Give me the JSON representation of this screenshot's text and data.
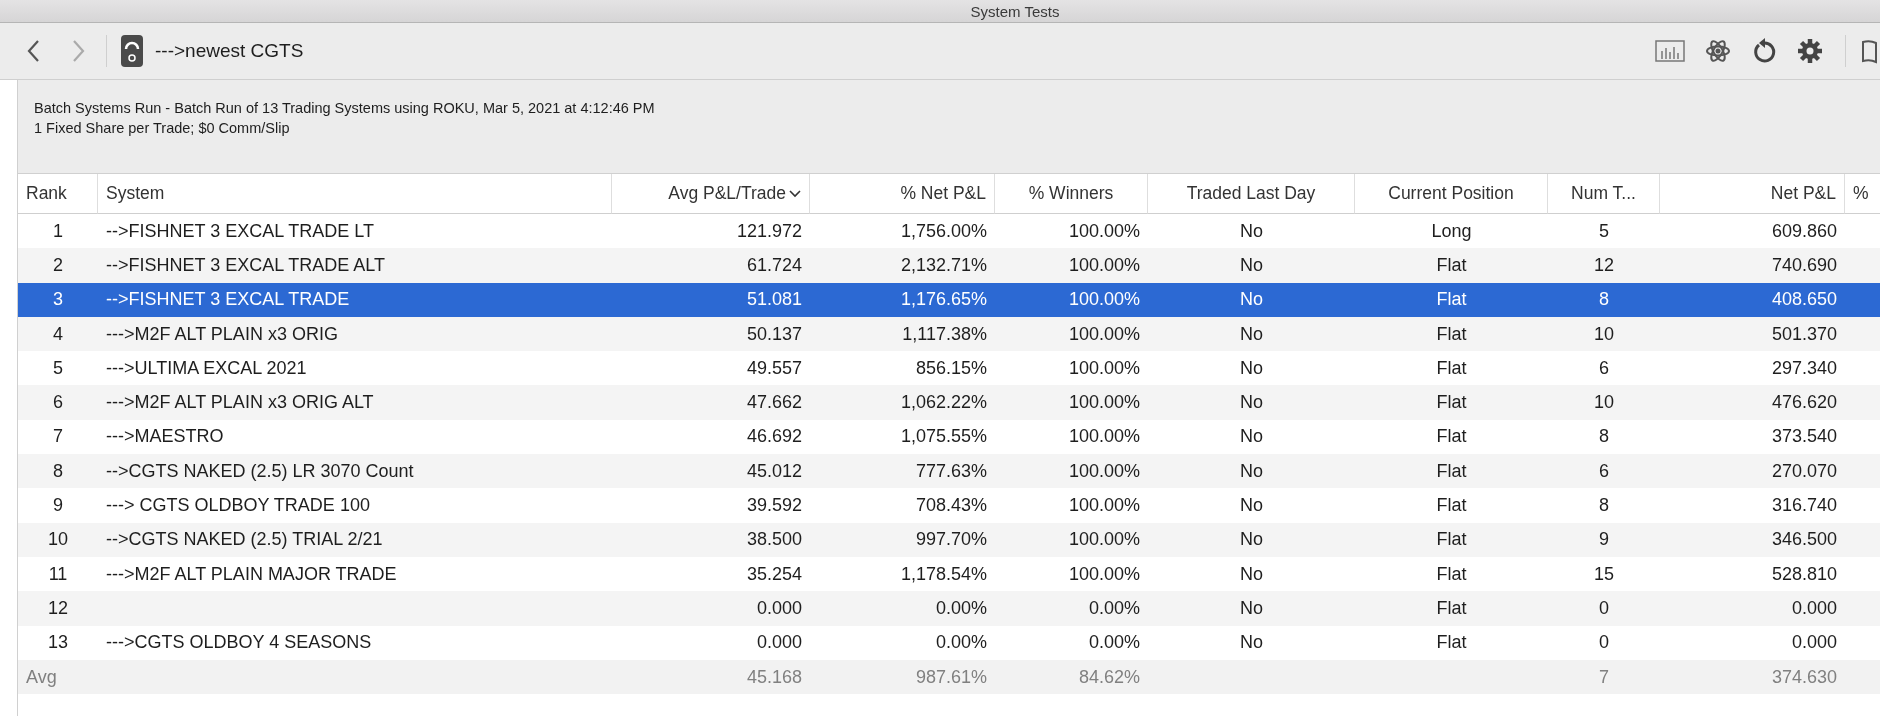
{
  "window": {
    "title": "System Tests"
  },
  "toolbar": {
    "location": "--->newest CGTS"
  },
  "info": {
    "lines": [
      "Batch Systems Run - Batch Run of 13 Trading Systems using ROKU, Mar 5, 2021 at 4:12:46 PM",
      "1 Fixed Share per Trade; $0 Comm/Slip"
    ]
  },
  "table": {
    "columns": [
      {
        "label": "Rank",
        "sorted": false
      },
      {
        "label": "System",
        "sorted": false
      },
      {
        "label": "Avg P&L/Trade",
        "sorted": true
      },
      {
        "label": "% Net P&L",
        "sorted": false
      },
      {
        "label": "% Winners",
        "sorted": false
      },
      {
        "label": "Traded Last Day",
        "sorted": false
      },
      {
        "label": "Current Position",
        "sorted": false
      },
      {
        "label": "Num T...",
        "sorted": false
      },
      {
        "label": "Net P&L",
        "sorted": false
      },
      {
        "label": "%",
        "sorted": false
      }
    ],
    "rows": [
      {
        "kind": "data",
        "selected": false,
        "cells": [
          "1",
          "-->FISHNET 3 EXCAL TRADE LT",
          "121.972",
          "1,756.00%",
          "100.00%",
          "No",
          "Long",
          "5",
          "609.860"
        ]
      },
      {
        "kind": "data",
        "selected": false,
        "cells": [
          "2",
          "-->FISHNET 3 EXCAL TRADE ALT",
          "61.724",
          "2,132.71%",
          "100.00%",
          "No",
          "Flat",
          "12",
          "740.690"
        ]
      },
      {
        "kind": "data",
        "selected": true,
        "cells": [
          "3",
          "-->FISHNET 3 EXCAL TRADE",
          "51.081",
          "1,176.65%",
          "100.00%",
          "No",
          "Flat",
          "8",
          "408.650"
        ]
      },
      {
        "kind": "data",
        "selected": false,
        "cells": [
          "4",
          "--->M2F ALT PLAIN x3 ORIG",
          "50.137",
          "1,117.38%",
          "100.00%",
          "No",
          "Flat",
          "10",
          "501.370"
        ]
      },
      {
        "kind": "data",
        "selected": false,
        "cells": [
          "5",
          "--->ULTIMA EXCAL 2021",
          "49.557",
          "856.15%",
          "100.00%",
          "No",
          "Flat",
          "6",
          "297.340"
        ]
      },
      {
        "kind": "data",
        "selected": false,
        "cells": [
          "6",
          "--->M2F ALT PLAIN x3 ORIG ALT",
          "47.662",
          "1,062.22%",
          "100.00%",
          "No",
          "Flat",
          "10",
          "476.620"
        ]
      },
      {
        "kind": "data",
        "selected": false,
        "cells": [
          "7",
          "--->MAESTRO",
          "46.692",
          "1,075.55%",
          "100.00%",
          "No",
          "Flat",
          "8",
          "373.540"
        ]
      },
      {
        "kind": "data",
        "selected": false,
        "cells": [
          "8",
          "-->CGTS NAKED (2.5) LR 3070 Count",
          "45.012",
          "777.63%",
          "100.00%",
          "No",
          "Flat",
          "6",
          "270.070"
        ]
      },
      {
        "kind": "data",
        "selected": false,
        "cells": [
          "9",
          "---> CGTS OLDBOY TRADE 100",
          "39.592",
          "708.43%",
          "100.00%",
          "No",
          "Flat",
          "8",
          "316.740"
        ]
      },
      {
        "kind": "data",
        "selected": false,
        "cells": [
          "10",
          "-->CGTS NAKED (2.5) TRIAL 2/21",
          "38.500",
          "997.70%",
          "100.00%",
          "No",
          "Flat",
          "9",
          "346.500"
        ]
      },
      {
        "kind": "data",
        "selected": false,
        "cells": [
          "11",
          "--->M2F ALT PLAIN MAJOR TRADE",
          "35.254",
          "1,178.54%",
          "100.00%",
          "No",
          "Flat",
          "15",
          "528.810"
        ]
      },
      {
        "kind": "data",
        "selected": false,
        "cells": [
          "12",
          "",
          "0.000",
          "0.00%",
          "0.00%",
          "No",
          "Flat",
          "0",
          "0.000"
        ]
      },
      {
        "kind": "data",
        "selected": false,
        "cells": [
          "13",
          "--->CGTS OLDBOY 4 SEASONS",
          "0.000",
          "0.00%",
          "0.00%",
          "No",
          "Flat",
          "0",
          "0.000"
        ]
      },
      {
        "kind": "summary",
        "selected": false,
        "cells": [
          "Avg",
          "",
          "45.168",
          "987.61%",
          "84.62%",
          "",
          "",
          "7",
          "374.630"
        ]
      }
    ]
  }
}
